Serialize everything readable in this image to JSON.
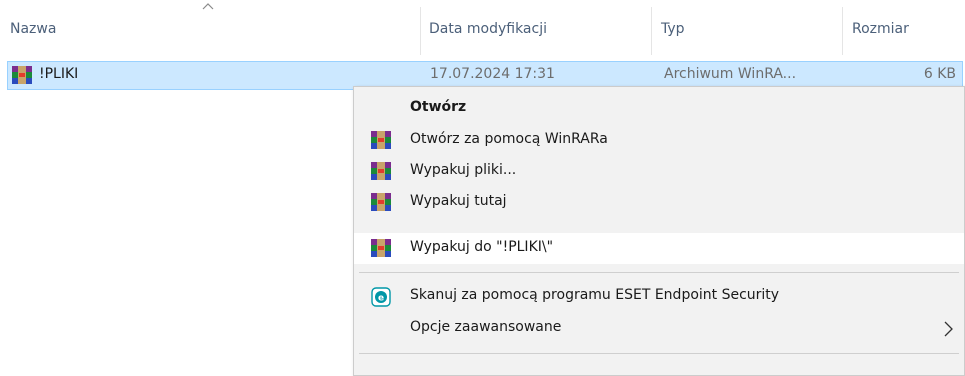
{
  "columns": {
    "name": "Nazwa",
    "modified": "Data modyfikacji",
    "type": "Typ",
    "size": "Rozmiar"
  },
  "file": {
    "name": "!PLIKI",
    "modified": "17.07.2024 17:31",
    "type": "Archiwum WinRA...",
    "size": "6 KB",
    "icon": "winrar-archive-icon"
  },
  "context_menu": {
    "open": "Otwórz",
    "open_with_winrar": "Otwórz za pomocą WinRARa",
    "extract_files": "Wypakuj pliki...",
    "extract_here": "Wypakuj tutaj",
    "extract_to": "Wypakuj do \"!PLIKI\\\"",
    "eset_scan": "Skanuj za pomocą programu ESET Endpoint Security",
    "advanced_options": "Opcje zaawansowane",
    "hovered_item": "extract_to"
  },
  "colors": {
    "selection_bg": "#cce8ff",
    "menu_bg": "#f2f2f2",
    "eset_accent": "#0097a7"
  }
}
